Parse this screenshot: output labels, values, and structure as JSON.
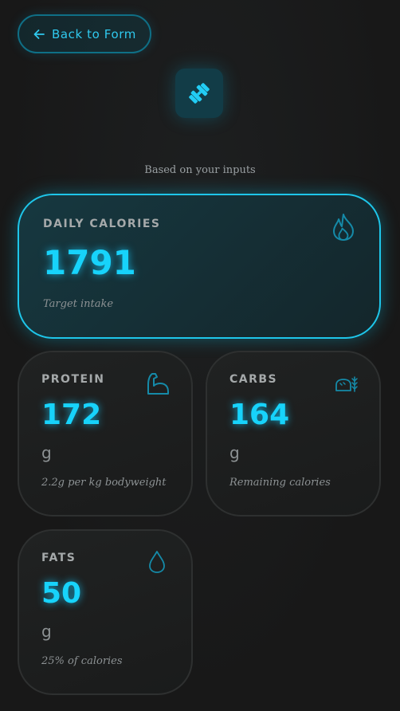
{
  "header": {
    "back_label": "Back to Form",
    "back_icon": "arrow-left-icon",
    "hero_icon": "dumbbell-icon"
  },
  "subtitle": "Based on your inputs",
  "accent_color": "#17d3fb",
  "daily_calories": {
    "label": "DAILY CALORIES",
    "value": "1791",
    "note": "Target intake",
    "icon": "flame-icon"
  },
  "protein": {
    "label": "PROTEIN",
    "value": "172",
    "unit": "g",
    "note": "2.2g per kg bodyweight",
    "icon": "flexed-arm-icon"
  },
  "carbs": {
    "label": "CARBS",
    "value": "164",
    "unit": "g",
    "note": "Remaining calories",
    "icon": "bread-wheat-icon"
  },
  "fats": {
    "label": "FATS",
    "value": "50",
    "unit": "g",
    "note": "25% of calories",
    "icon": "droplet-icon"
  }
}
